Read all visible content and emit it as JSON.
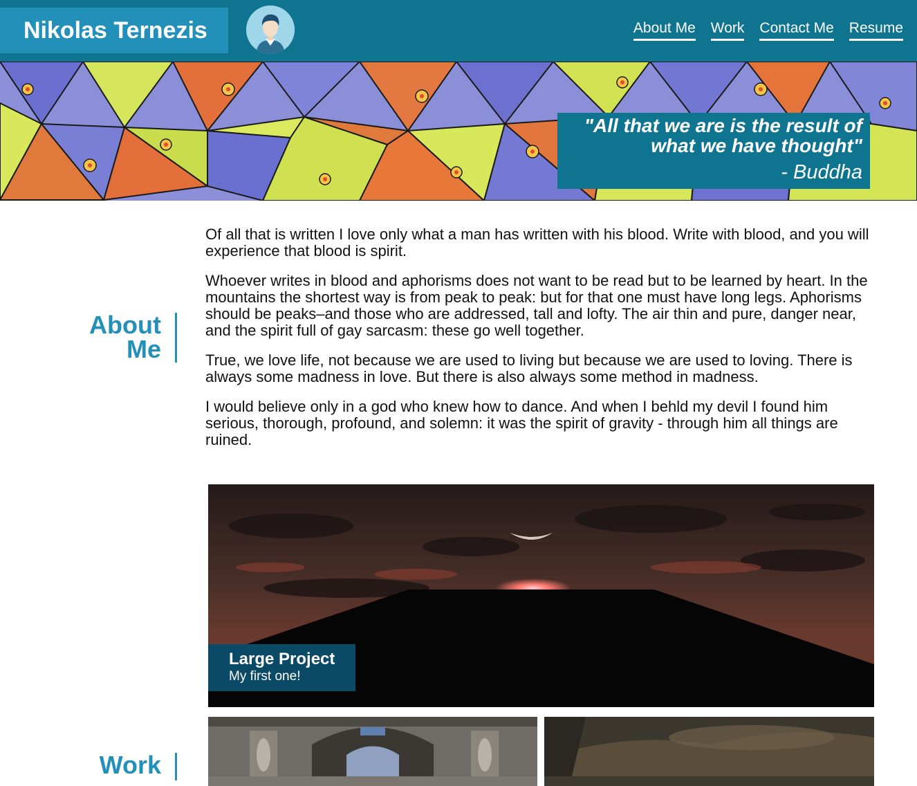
{
  "header": {
    "brand": "Nikolas Ternezis",
    "avatar_icon": "user-avatar-icon",
    "nav": [
      {
        "label": "About Me"
      },
      {
        "label": "Work"
      },
      {
        "label": "Contact Me"
      },
      {
        "label": "Resume"
      }
    ]
  },
  "hero": {
    "quote": "\"All that we are is the result of what we have thought\"",
    "author": "- Buddha"
  },
  "about": {
    "title": "About Me",
    "paragraphs": [
      "Of all that is written I love only what a man has written with his blood. Write with blood, and you will experience that blood is spirit.",
      "Whoever writes in blood and aphorisms does not want to be read but to be learned by heart. In the mountains the shortest way is from peak to peak: but for that one must have long legs. Aphorisms should be peaks–and those who are addressed, tall and lofty. The air thin and pure, danger near, and the spirit full of gay sarcasm: these go well together.",
      "True, we love life, not because we are used to living but because we are used to loving. There is always some madness in love. But there is also always some method in madness.",
      "I would believe only in a god who knew how to dance. And when I behld my devil I found him serious, thorough, profound, and solemn: it was the spirit of gravity - through him all things are ruined."
    ]
  },
  "work": {
    "title": "Work",
    "large_project": {
      "name": "Large Project",
      "subtitle": "My first one!"
    }
  },
  "colors": {
    "header_bg": "#0f7490",
    "brand_bg": "#2290b8",
    "accent": "#2290b8",
    "label_bg": "#0b4a66"
  }
}
